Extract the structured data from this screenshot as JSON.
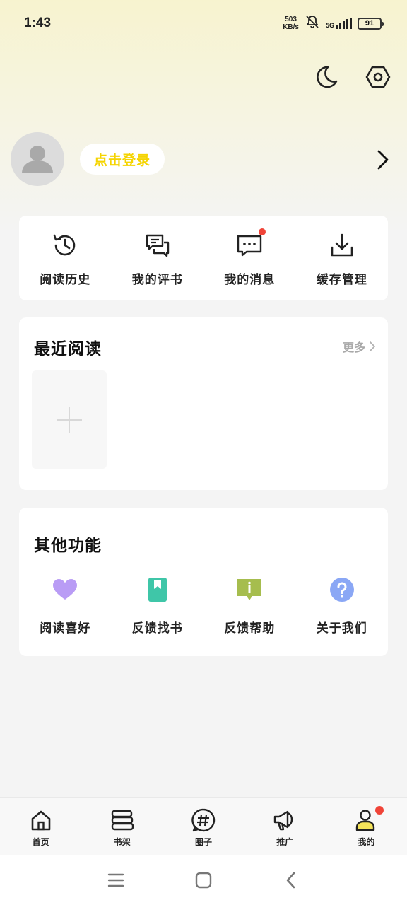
{
  "status_bar": {
    "time": "1:43",
    "net_speed_value": "503",
    "net_speed_unit": "KB/s",
    "network_type": "5G",
    "battery_level": "91"
  },
  "profile": {
    "login_label": "点击登录"
  },
  "quick_actions": [
    {
      "label": "阅读历史",
      "icon": "history-icon"
    },
    {
      "label": "我的评书",
      "icon": "comments-icon"
    },
    {
      "label": "我的消息",
      "icon": "message-icon",
      "badge": true
    },
    {
      "label": "缓存管理",
      "icon": "download-icon"
    }
  ],
  "recent_reading": {
    "title": "最近阅读",
    "more_label": "更多"
  },
  "other_functions": {
    "title": "其他功能",
    "items": [
      {
        "label": "阅读喜好",
        "icon": "heart-icon",
        "color": "#b99cf5"
      },
      {
        "label": "反馈找书",
        "icon": "bookmark-icon",
        "color": "#3fc6a8"
      },
      {
        "label": "反馈帮助",
        "icon": "info-board-icon",
        "color": "#a6bd4e"
      },
      {
        "label": "关于我们",
        "icon": "question-icon",
        "color": "#8aa7f5"
      }
    ]
  },
  "tab_bar": [
    {
      "label": "首页",
      "icon": "home-icon"
    },
    {
      "label": "书架",
      "icon": "bookshelf-icon"
    },
    {
      "label": "圈子",
      "icon": "hashtag-icon"
    },
    {
      "label": "推广",
      "icon": "megaphone-icon"
    },
    {
      "label": "我的",
      "icon": "user-icon",
      "active": true,
      "badge": true
    }
  ],
  "colors": {
    "accent_yellow": "#f5d400",
    "badge_red": "#f04438"
  }
}
